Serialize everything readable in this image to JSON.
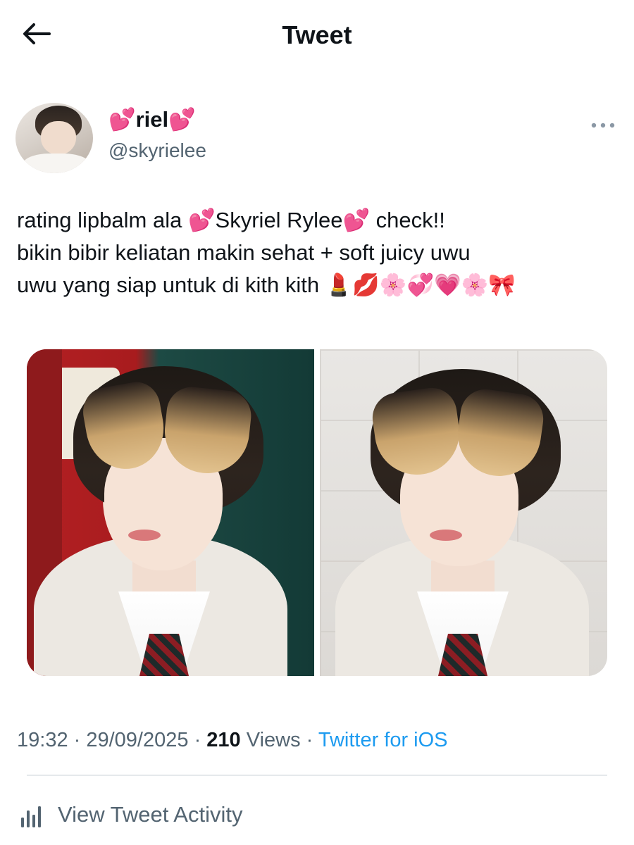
{
  "header": {
    "title": "Tweet",
    "back_icon": "arrow-left-icon"
  },
  "author": {
    "display_name": "💕riel💕",
    "handle": "@skyrielee",
    "more_icon": "more-horizontal-icon"
  },
  "tweet": {
    "text": "rating lipbalm ala 💕Skyriel Rylee💕 check!!\nbikin bibir keliatan makin sehat + soft juicy uwu\nuwu yang siap untuk di kith kith 💄💋🌸💞💗🌸🎀"
  },
  "media": {
    "count": 2
  },
  "meta": {
    "time": "19:32",
    "separator": " · ",
    "date": "29/09/2025",
    "views_count": "210",
    "views_label": " Views",
    "source": "Twitter for iOS"
  },
  "activity": {
    "label": "View Tweet Activity",
    "icon": "bar-chart-icon"
  },
  "colors": {
    "text_primary": "#0f1419",
    "text_secondary": "#536471",
    "link": "#1d9bf0",
    "divider": "#e5e9ec"
  }
}
